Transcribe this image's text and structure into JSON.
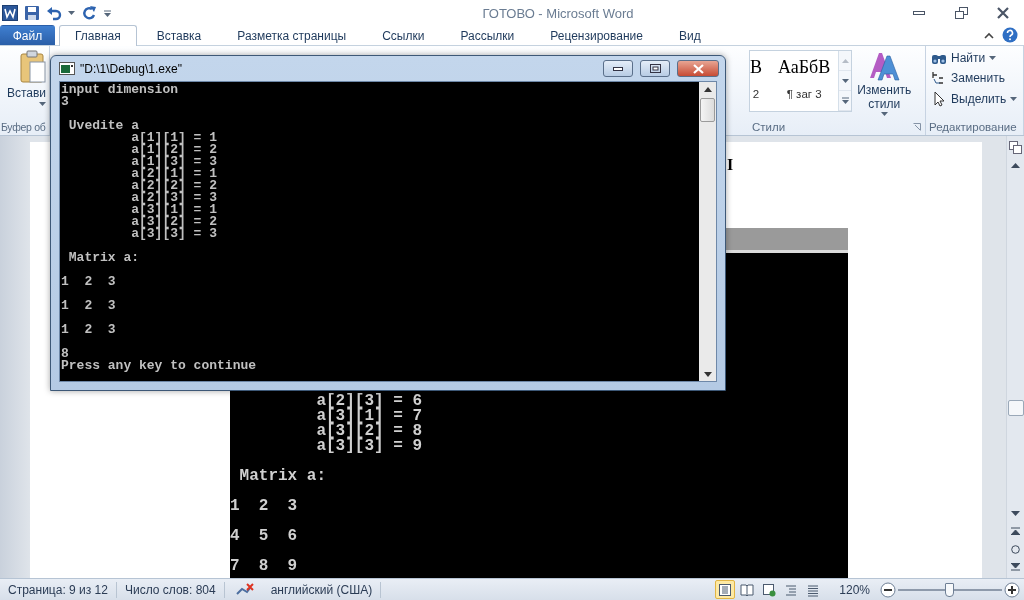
{
  "word": {
    "title": "ГОТОВО - Microsoft Word",
    "tabs": [
      {
        "label": "Файл",
        "kind": "file",
        "selected": false
      },
      {
        "label": "Главная",
        "kind": "tab",
        "selected": true
      },
      {
        "label": "Вставка",
        "kind": "tab",
        "selected": false
      },
      {
        "label": "Разметка страницы",
        "kind": "tab",
        "selected": false
      },
      {
        "label": "Ссылки",
        "kind": "tab",
        "selected": false
      },
      {
        "label": "Рассылки",
        "kind": "tab",
        "selected": false
      },
      {
        "label": "Рецензирование",
        "kind": "tab",
        "selected": false
      },
      {
        "label": "Вид",
        "kind": "tab",
        "selected": false
      }
    ],
    "ribbon": {
      "clipboard": {
        "paste_label": "Встави",
        "group_label": "Буфер об"
      },
      "styles": {
        "gallery": [
          {
            "sample": "В",
            "name": "2"
          },
          {
            "sample": "АаБбВ",
            "name": "¶ заг 3"
          }
        ],
        "change_styles": "Изменить стили",
        "group_label": "Стили"
      },
      "editing": {
        "buttons": [
          {
            "label": "Найти",
            "kind": "find",
            "dropdown": true
          },
          {
            "label": "Заменить",
            "kind": "replace",
            "dropdown": false
          },
          {
            "label": "Выделить",
            "kind": "select",
            "dropdown": true
          }
        ],
        "group_label": "Редактирование"
      }
    },
    "document": {
      "heading_fragment": "I",
      "embedded_console": {
        "output": "         a[2][3] = 6\n         a[3][1] = 7\n         a[3][2] = 8\n         a[3][3] = 9\n\n Matrix a:\n\n1  2  3\n\n4  5  6\n\n7  8  9"
      }
    },
    "status_bar": {
      "page": "Страница: 9 из 12",
      "words": "Число слов: 804",
      "language": "английский (США)",
      "views": [
        {
          "kind": "print",
          "selected": true
        },
        {
          "kind": "reading",
          "selected": false
        },
        {
          "kind": "web",
          "selected": false
        },
        {
          "kind": "outline",
          "selected": false
        },
        {
          "kind": "draft",
          "selected": false
        }
      ],
      "zoom": "120%",
      "zoom_slider": {
        "level": 0.5
      }
    }
  },
  "console": {
    "title": "\"D:\\1\\Debug\\1.exe\"",
    "output": "input dimension\n3\n\n Uvedite a\n         a[1][1] = 1\n         a[1][2] = 2\n         a[1][3] = 3\n         a[2][1] = 1\n         a[2][2] = 2\n         a[2][3] = 3\n         a[3][1] = 1\n         a[3][2] = 2\n         a[3][3] = 3\n\n Matrix a:\n\n1  2  3\n\n1  2  3\n\n1  2  3\n\n8\nPress any key to continue"
  }
}
